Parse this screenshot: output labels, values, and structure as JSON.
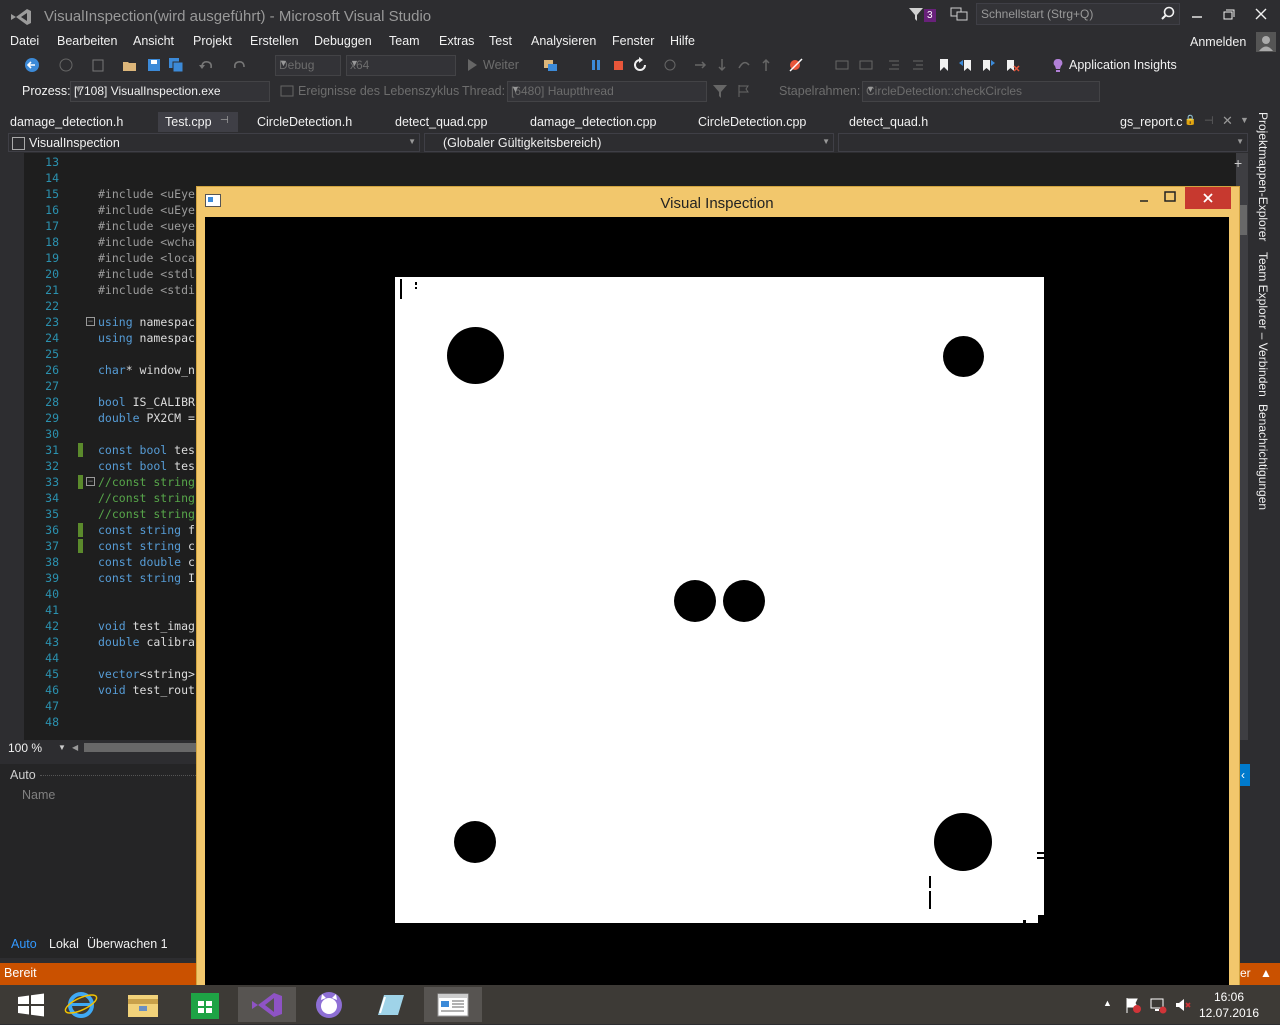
{
  "window": {
    "title": "VisualInspection(wird ausgeführt) - Microsoft Visual Studio",
    "notification_count": "3",
    "quick_launch_placeholder": "Schnellstart (Strg+Q)"
  },
  "menu": [
    "Datei",
    "Bearbeiten",
    "Ansicht",
    "Projekt",
    "Erstellen",
    "Debuggen",
    "Team",
    "Extras",
    "Test",
    "Analysieren",
    "Fenster",
    "Hilfe"
  ],
  "account": {
    "sign_in_label": "Anmelden"
  },
  "toolbar": {
    "config": "Debug",
    "platform": "x64",
    "continue_label": "Weiter",
    "app_insights_label": "Application Insights"
  },
  "debug_location": {
    "process_label": "Prozess:",
    "process_value": "[7108] VisualInspection.exe",
    "lifecycle_label": "Ereignisse des Lebenszyklus",
    "thread_label": "Thread:",
    "thread_value": "[6480] Hauptthread",
    "stackframe_label": "Stapelrahmen:",
    "stackframe_value": "CircleDetection::checkCircles"
  },
  "tabs": [
    "damage_detection.h",
    "Test.cpp",
    "CircleDetection.h",
    "detect_quad.cpp",
    "damage_detection.cpp",
    "CircleDetection.cpp",
    "detect_quad.h",
    "gs_report.c"
  ],
  "navigation": {
    "project": "VisualInspection",
    "scope": "(Globaler Gültigkeitsbereich)"
  },
  "code_lines": [
    {
      "n": "13",
      "t": ""
    },
    {
      "n": "14",
      "t": ""
    },
    {
      "n": "15",
      "t": "#include <uEye"
    },
    {
      "n": "16",
      "t": "#include <uEye"
    },
    {
      "n": "17",
      "t": "#include <ueye"
    },
    {
      "n": "18",
      "t": "#include <wcha"
    },
    {
      "n": "19",
      "t": "#include <loca"
    },
    {
      "n": "20",
      "t": "#include <stdl"
    },
    {
      "n": "21",
      "t": "#include <stdi"
    },
    {
      "n": "22",
      "t": ""
    },
    {
      "n": "23",
      "t": "using namespac"
    },
    {
      "n": "24",
      "t": "using namespac"
    },
    {
      "n": "25",
      "t": ""
    },
    {
      "n": "26",
      "t": "char* window_n"
    },
    {
      "n": "27",
      "t": ""
    },
    {
      "n": "28",
      "t": "bool IS_CALIBR"
    },
    {
      "n": "29",
      "t": "double PX2CM ="
    },
    {
      "n": "30",
      "t": ""
    },
    {
      "n": "31",
      "t": "const bool tes"
    },
    {
      "n": "32",
      "t": "const bool tes"
    },
    {
      "n": "33",
      "t": "//const string"
    },
    {
      "n": "34",
      "t": "//const string"
    },
    {
      "n": "35",
      "t": "//const string"
    },
    {
      "n": "36",
      "t": "const string f"
    },
    {
      "n": "37",
      "t": "const string c"
    },
    {
      "n": "38",
      "t": "const double c"
    },
    {
      "n": "39",
      "t": "const string I"
    },
    {
      "n": "40",
      "t": ""
    },
    {
      "n": "41",
      "t": ""
    },
    {
      "n": "42",
      "t": "void test_imag"
    },
    {
      "n": "43",
      "t": "double calibra"
    },
    {
      "n": "44",
      "t": ""
    },
    {
      "n": "45",
      "t": "vector<string>"
    },
    {
      "n": "46",
      "t": "void test_rout"
    },
    {
      "n": "47",
      "t": ""
    },
    {
      "n": "48",
      "t": ""
    }
  ],
  "editor": {
    "zoom": "100 %"
  },
  "auto_panel": {
    "title": "Auto",
    "column_name": "Name",
    "tabs": [
      "Auto",
      "Lokal",
      "Überwachen 1"
    ]
  },
  "right_panels": [
    "Projektmappen-Explorer",
    "Team Explorer – Verbinden",
    "Benachrichtigungen"
  ],
  "status": {
    "text": "Bereit"
  },
  "inspection_window": {
    "title": "Visual Inspection"
  },
  "clock": {
    "time": "16:06",
    "date": "12.07.2016"
  },
  "colors": {
    "accent": "#007acc",
    "status_bar": "#ca5100",
    "window_frame": "#f2c76c"
  }
}
